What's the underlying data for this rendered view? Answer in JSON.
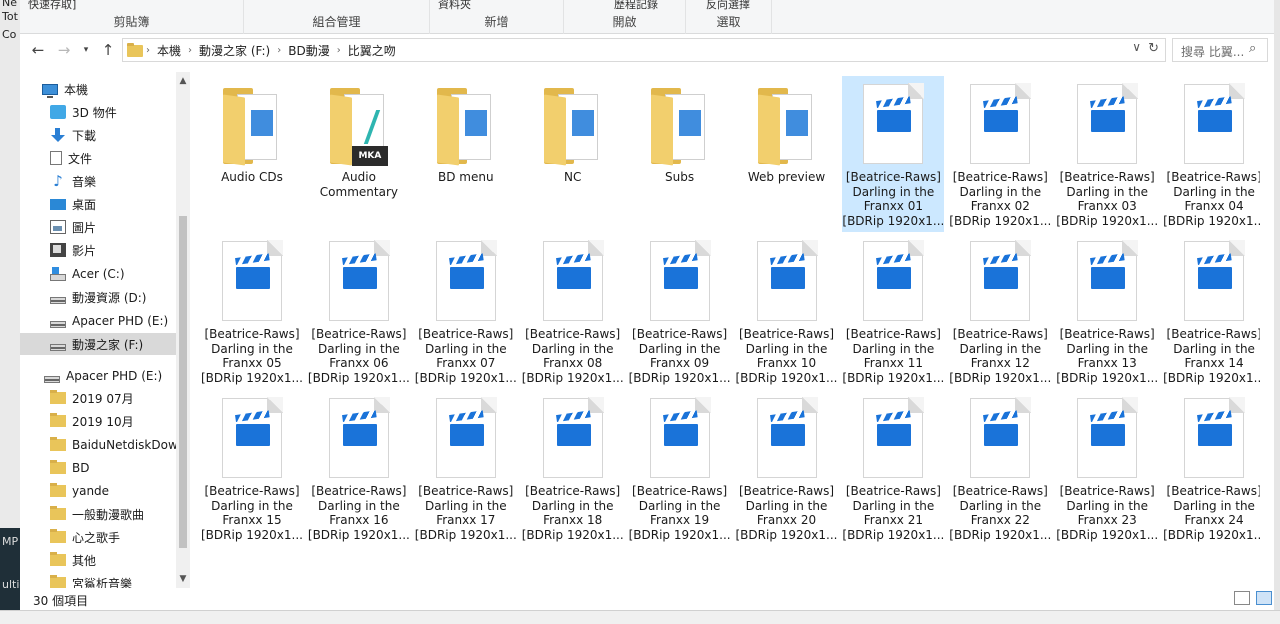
{
  "background": {
    "left_text": [
      "Ne",
      "Tot",
      "Co",
      "MP",
      "ulti-"
    ]
  },
  "ribbon": {
    "groups": [
      {
        "label": "剪貼簿",
        "top": "快速存取]"
      },
      {
        "label": "組合管理",
        "top": ""
      },
      {
        "label": "新增",
        "top": "資料夾"
      },
      {
        "label": "開啟",
        "top": "歷程記錄"
      },
      {
        "label": "選取",
        "top": "反向選擇"
      }
    ]
  },
  "nav": {
    "breadcrumbs": [
      "本機",
      "動漫之家 (F:)",
      "BD動漫",
      "比翼之吻"
    ],
    "search_placeholder": "搜尋 比翼..."
  },
  "sidebar": {
    "items": [
      {
        "label": "本機",
        "icon": "pc",
        "level": 0
      },
      {
        "label": "3D 物件",
        "icon": "cube",
        "level": 1
      },
      {
        "label": "下載",
        "icon": "down",
        "level": 1
      },
      {
        "label": "文件",
        "icon": "doc",
        "level": 1
      },
      {
        "label": "音樂",
        "icon": "note",
        "level": 1
      },
      {
        "label": "桌面",
        "icon": "desk",
        "level": 1
      },
      {
        "label": "圖片",
        "icon": "pic",
        "level": 1
      },
      {
        "label": "影片",
        "icon": "vid",
        "level": 1
      },
      {
        "label": "Acer (C:)",
        "icon": "drivewin",
        "level": 1
      },
      {
        "label": "動漫資源 (D:)",
        "icon": "drive",
        "level": 1
      },
      {
        "label": "Apacer PHD (E:)",
        "icon": "drive",
        "level": 1
      },
      {
        "label": "動漫之家 (F:)",
        "icon": "drive",
        "level": 1,
        "selected": true
      },
      {
        "label": "Apacer PHD (E:)",
        "icon": "drive",
        "level": 0
      },
      {
        "label": "2019 07月",
        "icon": "folder",
        "level": 1
      },
      {
        "label": "2019 10月",
        "icon": "folder",
        "level": 1
      },
      {
        "label": "BaiduNetdiskDown",
        "icon": "folder",
        "level": 1
      },
      {
        "label": "BD",
        "icon": "folder",
        "level": 1
      },
      {
        "label": "yande",
        "icon": "folder",
        "level": 1
      },
      {
        "label": "一般動漫歌曲",
        "icon": "folder",
        "level": 1
      },
      {
        "label": "心之歌手",
        "icon": "folder",
        "level": 1
      },
      {
        "label": "其他",
        "icon": "folder",
        "level": 1
      },
      {
        "label": "宮鯊析音樂",
        "icon": "folder",
        "level": 1
      }
    ]
  },
  "files": [
    {
      "type": "folder",
      "lines": [
        "Audio CDs"
      ]
    },
    {
      "type": "folder-mka",
      "lines": [
        "Audio",
        "Commentary"
      ]
    },
    {
      "type": "folder",
      "lines": [
        "BD menu"
      ]
    },
    {
      "type": "folder",
      "lines": [
        "NC"
      ]
    },
    {
      "type": "folder",
      "lines": [
        "Subs"
      ]
    },
    {
      "type": "folder",
      "lines": [
        "Web preview"
      ]
    },
    {
      "type": "video",
      "lines": [
        "[Beatrice-Raws]",
        "Darling in the",
        "Franxx 01",
        "[BDRip 1920x1..."
      ],
      "selected": true
    },
    {
      "type": "video",
      "lines": [
        "[Beatrice-Raws]",
        "Darling in the",
        "Franxx 02",
        "[BDRip 1920x1..."
      ]
    },
    {
      "type": "video",
      "lines": [
        "[Beatrice-Raws]",
        "Darling in the",
        "Franxx 03",
        "[BDRip 1920x1..."
      ]
    },
    {
      "type": "video",
      "lines": [
        "[Beatrice-Raws]",
        "Darling in the",
        "Franxx 04",
        "[BDRip 1920x1..."
      ]
    },
    {
      "type": "video",
      "lines": [
        "[Beatrice-Raws]",
        "Darling in the",
        "Franxx 05",
        "[BDRip 1920x1..."
      ]
    },
    {
      "type": "video",
      "lines": [
        "[Beatrice-Raws]",
        "Darling in the",
        "Franxx 06",
        "[BDRip 1920x1..."
      ]
    },
    {
      "type": "video",
      "lines": [
        "[Beatrice-Raws]",
        "Darling in the",
        "Franxx 07",
        "[BDRip 1920x1..."
      ]
    },
    {
      "type": "video",
      "lines": [
        "[Beatrice-Raws]",
        "Darling in the",
        "Franxx 08",
        "[BDRip 1920x1..."
      ]
    },
    {
      "type": "video",
      "lines": [
        "[Beatrice-Raws]",
        "Darling in the",
        "Franxx 09",
        "[BDRip 1920x1..."
      ]
    },
    {
      "type": "video",
      "lines": [
        "[Beatrice-Raws]",
        "Darling in the",
        "Franxx 10",
        "[BDRip 1920x1..."
      ]
    },
    {
      "type": "video",
      "lines": [
        "[Beatrice-Raws]",
        "Darling in the",
        "Franxx 11",
        "[BDRip 1920x1..."
      ]
    },
    {
      "type": "video",
      "lines": [
        "[Beatrice-Raws]",
        "Darling in the",
        "Franxx 12",
        "[BDRip 1920x1..."
      ]
    },
    {
      "type": "video",
      "lines": [
        "[Beatrice-Raws]",
        "Darling in the",
        "Franxx 13",
        "[BDRip 1920x1..."
      ]
    },
    {
      "type": "video",
      "lines": [
        "[Beatrice-Raws]",
        "Darling in the",
        "Franxx 14",
        "[BDRip 1920x1..."
      ]
    },
    {
      "type": "video",
      "lines": [
        "[Beatrice-Raws]",
        "Darling in the",
        "Franxx 15",
        "[BDRip 1920x1..."
      ]
    },
    {
      "type": "video",
      "lines": [
        "[Beatrice-Raws]",
        "Darling in the",
        "Franxx 16",
        "[BDRip 1920x1..."
      ]
    },
    {
      "type": "video",
      "lines": [
        "[Beatrice-Raws]",
        "Darling in the",
        "Franxx 17",
        "[BDRip 1920x1..."
      ]
    },
    {
      "type": "video",
      "lines": [
        "[Beatrice-Raws]",
        "Darling in the",
        "Franxx 18",
        "[BDRip 1920x1..."
      ]
    },
    {
      "type": "video",
      "lines": [
        "[Beatrice-Raws]",
        "Darling in the",
        "Franxx 19",
        "[BDRip 1920x1..."
      ]
    },
    {
      "type": "video",
      "lines": [
        "[Beatrice-Raws]",
        "Darling in the",
        "Franxx 20",
        "[BDRip 1920x1..."
      ]
    },
    {
      "type": "video",
      "lines": [
        "[Beatrice-Raws]",
        "Darling in the",
        "Franxx 21",
        "[BDRip 1920x1..."
      ]
    },
    {
      "type": "video",
      "lines": [
        "[Beatrice-Raws]",
        "Darling in the",
        "Franxx 22",
        "[BDRip 1920x1..."
      ]
    },
    {
      "type": "video",
      "lines": [
        "[Beatrice-Raws]",
        "Darling in the",
        "Franxx 23",
        "[BDRip 1920x1..."
      ]
    },
    {
      "type": "video",
      "lines": [
        "[Beatrice-Raws]",
        "Darling in the",
        "Franxx 24",
        "[BDRip 1920x1..."
      ]
    }
  ],
  "status": {
    "item_count": "30 個項目"
  },
  "colors": {
    "selection": "#cce8ff",
    "video_icon": "#1a73d9",
    "folder": "#f2cf6d"
  }
}
